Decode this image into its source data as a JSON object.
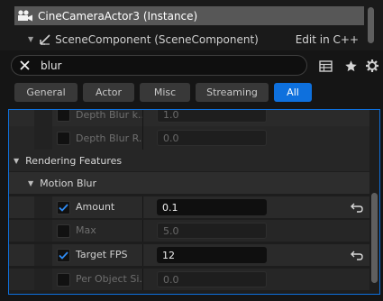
{
  "component_tree": {
    "root_label": "CineCameraActor3 (Instance)",
    "child_label": "SceneComponent (SceneComponent)",
    "edit_link": "Edit in C++"
  },
  "search": {
    "value": "blur"
  },
  "tabs": [
    {
      "label": "General",
      "active": false
    },
    {
      "label": "Actor",
      "active": false
    },
    {
      "label": "Misc",
      "active": false
    },
    {
      "label": "Streaming",
      "active": false
    },
    {
      "label": "All",
      "active": true
    }
  ],
  "details": {
    "top_props": [
      {
        "label": "Depth Blur k...",
        "value": "1.0",
        "checked": false
      },
      {
        "label": "Depth Blur R...",
        "value": "0.0",
        "checked": false
      }
    ],
    "category": "Rendering Features",
    "subcategory": "Motion Blur",
    "motion_props": [
      {
        "label": "Amount",
        "value": "0.1",
        "checked": true,
        "resettable": true
      },
      {
        "label": "Max",
        "value": "5.0",
        "checked": false,
        "resettable": false
      },
      {
        "label": "Target FPS",
        "value": "12",
        "checked": true,
        "resettable": true
      },
      {
        "label": "Per Object Si...",
        "value": "0.0",
        "checked": false,
        "resettable": false
      }
    ]
  },
  "icons": {
    "camera": "camera-actor-icon",
    "component": "scene-component-icon",
    "clear": "close-icon",
    "table": "table-view-icon",
    "favorite": "star-icon",
    "settings": "gear-icon",
    "reset": "reset-arrow-icon"
  },
  "colors": {
    "accent": "#0e70dd",
    "selected_row": "#575757",
    "panel_bg": "#1d1d1d"
  }
}
